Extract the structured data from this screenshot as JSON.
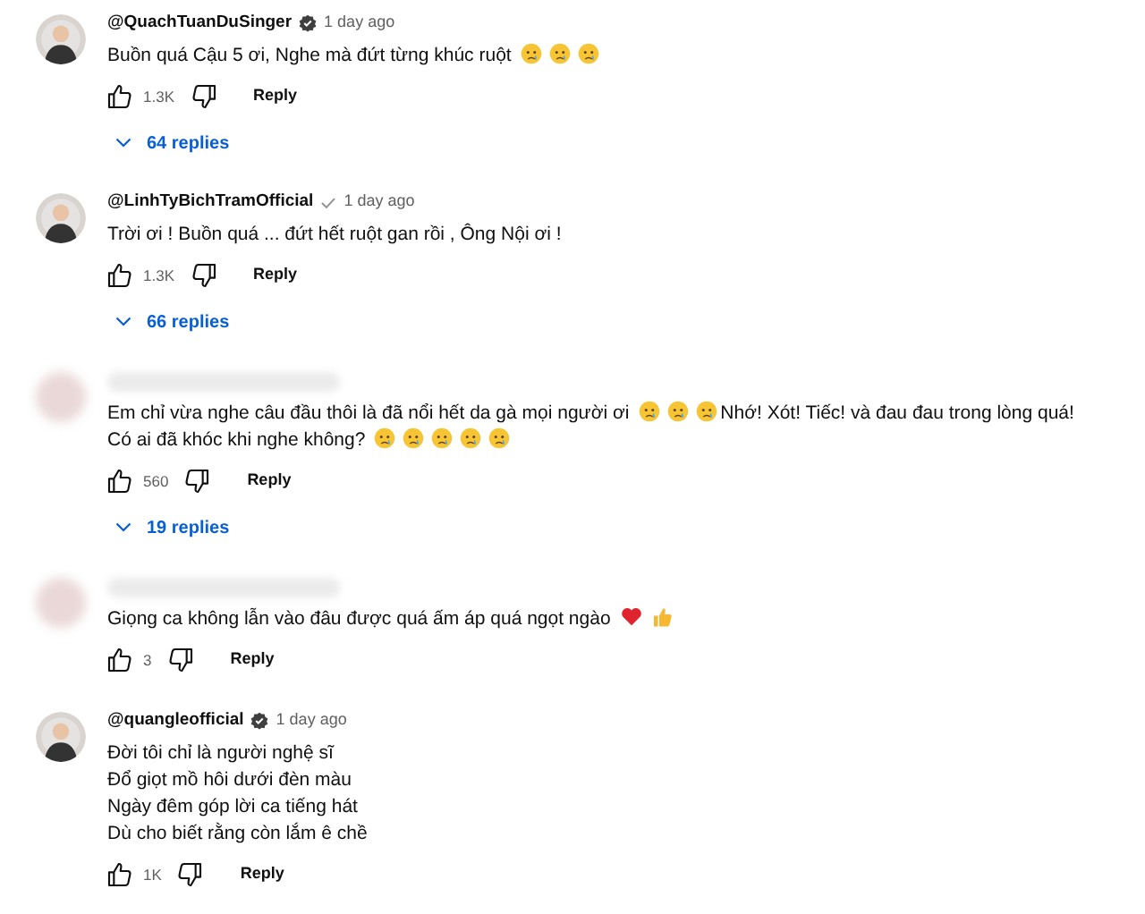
{
  "comments": [
    {
      "author": "@QuachTuanDuSinger",
      "redacted": false,
      "badge": {
        "kind": "verified"
      },
      "time": "1 day ago",
      "lines": [
        [
          {
            "kind": "text",
            "text": "Buồn quá Cậu 5 ơi, Nghe mà đứt từng khúc ruột"
          },
          {
            "kind": "crying-face"
          },
          {
            "kind": "crying-face"
          },
          {
            "kind": "crying-face"
          }
        ]
      ],
      "likes": "1.3K",
      "reply": "Reply",
      "replies": "64 replies"
    },
    {
      "author": "@LinhTyBichTramOfficial",
      "redacted": false,
      "badge": {
        "kind": "check"
      },
      "time": "1 day ago",
      "lines": [
        [
          {
            "kind": "text",
            "text": "Trời ơi ! Buồn quá ... đứt hết ruột gan rồi , Ông Nội ơi !"
          }
        ]
      ],
      "likes": "1.3K",
      "reply": "Reply",
      "replies": "66 replies"
    },
    {
      "redacted": true,
      "lines": [
        [
          {
            "kind": "text",
            "text": "Em chỉ vừa nghe câu đầu thôi là đã nổi hết da gà mọi người ơi"
          },
          {
            "kind": "crying-face"
          },
          {
            "kind": "crying-face"
          },
          {
            "kind": "crying-face"
          },
          {
            "kind": "text",
            "text": "Nhớ! Xót! Tiếc! và đau đau trong lòng quá!"
          }
        ],
        [
          {
            "kind": "text",
            "text": "Có ai đã khóc khi nghe không?"
          },
          {
            "kind": "crying-face"
          },
          {
            "kind": "crying-face"
          },
          {
            "kind": "crying-face"
          },
          {
            "kind": "crying-face"
          },
          {
            "kind": "crying-face"
          }
        ]
      ],
      "likes": "560",
      "reply": "Reply",
      "replies": "19 replies"
    },
    {
      "redacted": true,
      "lines": [
        [
          {
            "kind": "text",
            "text": "Giọng ca không lẫn vào đâu được quá ấm áp quá ngọt ngào"
          },
          {
            "kind": "heart"
          },
          {
            "kind": "thumbs-up"
          }
        ]
      ],
      "likes": "3",
      "reply": "Reply"
    },
    {
      "author": "@quangleofficial",
      "redacted": false,
      "badge": {
        "kind": "verified"
      },
      "time": "1 day ago",
      "lines": [
        [
          {
            "kind": "text",
            "text": "Đời tôi chỉ là người nghệ sĩ"
          }
        ],
        [
          {
            "kind": "text",
            "text": "Đổ giọt mồ hôi dưới đèn màu"
          }
        ],
        [
          {
            "kind": "text",
            "text": "Ngày đêm góp lời ca tiếng hát"
          }
        ],
        [
          {
            "kind": "text",
            "text": "Dù cho biết rằng còn lắm ê chề"
          }
        ]
      ],
      "likes": "1K",
      "reply": "Reply"
    }
  ]
}
